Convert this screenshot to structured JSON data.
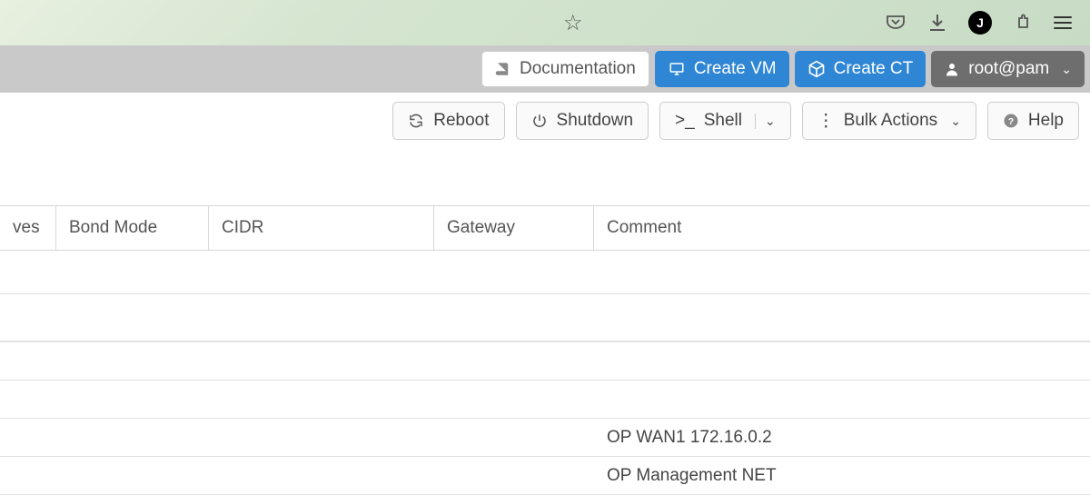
{
  "browser": {
    "icons": {
      "star": "star",
      "pocket": "pocket",
      "download": "download",
      "avatar_letter": "J",
      "extension": "extension",
      "menu": "menu"
    }
  },
  "header": {
    "documentation": "Documentation",
    "create_vm": "Create VM",
    "create_ct": "Create CT",
    "user": "root@pam"
  },
  "toolbar": {
    "reboot": "Reboot",
    "shutdown": "Shutdown",
    "shell": "Shell",
    "bulk_actions": "Bulk Actions",
    "help": "Help"
  },
  "table": {
    "headers": {
      "ves": "ves",
      "bond_mode": "Bond Mode",
      "cidr": "CIDR",
      "gateway": "Gateway",
      "comment": "Comment"
    },
    "rows": [
      {
        "comment": ""
      },
      {
        "comment": ""
      },
      {
        "comment": ""
      },
      {
        "comment": "OP WAN1 172.16.0.2"
      },
      {
        "comment": "OP Management NET"
      }
    ]
  }
}
